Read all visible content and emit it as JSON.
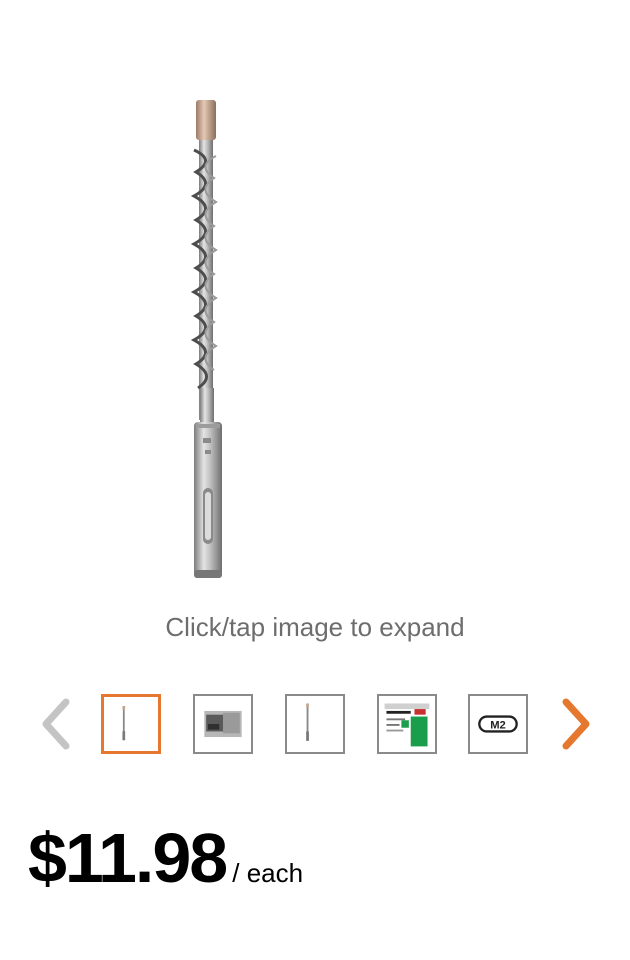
{
  "product": {
    "image_icon": "sds-plus-drill-bit",
    "expand_hint": "Click/tap image to expand"
  },
  "gallery": {
    "prev_icon": "chevron-left-icon",
    "next_icon": "chevron-right-icon",
    "prev_color": "#c4c4c4",
    "next_color": "#e5772e",
    "active_index": 0,
    "thumbnails": [
      {
        "icon": "drill-bit-thumbnail"
      },
      {
        "icon": "drilling-in-use-thumbnail"
      },
      {
        "icon": "drill-bit-thumbnail"
      },
      {
        "icon": "packaging-thumbnail"
      },
      {
        "icon": "m2-logo-thumbnail",
        "text": "M2"
      }
    ]
  },
  "price": {
    "amount": "$11.98",
    "unit": "/ each"
  },
  "colors": {
    "accent": "#e5772e",
    "hint_text": "#6d6d6d"
  }
}
